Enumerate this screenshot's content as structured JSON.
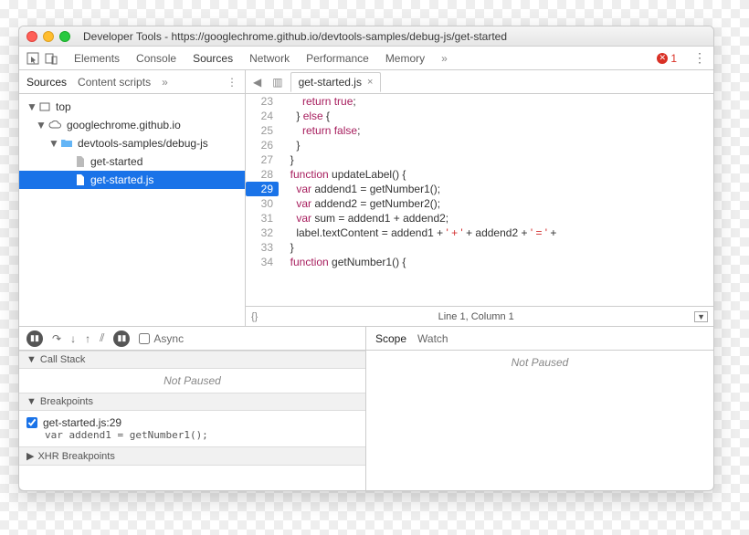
{
  "window": {
    "title": "Developer Tools - https://googlechrome.github.io/devtools-samples/debug-js/get-started"
  },
  "toolbar": {
    "tabs": [
      "Elements",
      "Console",
      "Sources",
      "Network",
      "Performance",
      "Memory"
    ],
    "active_tab": "Sources",
    "more": "»",
    "error_count": "1"
  },
  "sources_sidebar": {
    "tabs": [
      "Sources",
      "Content scripts"
    ],
    "more": "»",
    "tree": {
      "top": "top",
      "domain": "googlechrome.github.io",
      "folder": "devtools-samples/debug-js",
      "file1": "get-started",
      "file2": "get-started.js"
    }
  },
  "editor": {
    "filename": "get-started.js",
    "nav_back": "◀",
    "toggle": "▥",
    "lines": [
      {
        "n": "23",
        "html": "      <span class='kw'>return</span> <span class='kw'>true</span>;"
      },
      {
        "n": "24",
        "html": "    } <span class='kw'>else</span> {"
      },
      {
        "n": "25",
        "html": "      <span class='kw'>return</span> <span class='kw'>false</span>;"
      },
      {
        "n": "26",
        "html": "    }"
      },
      {
        "n": "27",
        "html": "  }"
      },
      {
        "n": "28",
        "html": "  <span class='kw'>function</span> updateLabel() {"
      },
      {
        "n": "29",
        "html": "    <span class='kw'>var</span> addend1 = getNumber1();",
        "bp": true
      },
      {
        "n": "30",
        "html": "    <span class='kw'>var</span> addend2 = getNumber2();"
      },
      {
        "n": "31",
        "html": "    <span class='kw'>var</span> sum = addend1 + addend2;"
      },
      {
        "n": "32",
        "html": "    label.textContent = addend1 + <span class='str'>' + '</span> + addend2 + <span class='str'>' = '</span> +"
      },
      {
        "n": "33",
        "html": "  }"
      },
      {
        "n": "34",
        "html": "  <span class='kw'>function</span> getNumber1() {"
      }
    ],
    "status": "Line 1, Column 1",
    "braces": "{}"
  },
  "debugger": {
    "controls": {
      "async_label": "Async"
    },
    "call_stack": {
      "title": "Call Stack",
      "state": "Not Paused"
    },
    "breakpoints": {
      "title": "Breakpoints",
      "items": [
        {
          "label": "get-started.js:29",
          "code": "var addend1 = getNumber1();",
          "checked": true
        }
      ]
    },
    "xhr": {
      "title": "XHR Breakpoints"
    },
    "right_tabs": [
      "Scope",
      "Watch"
    ],
    "right_state": "Not Paused"
  }
}
